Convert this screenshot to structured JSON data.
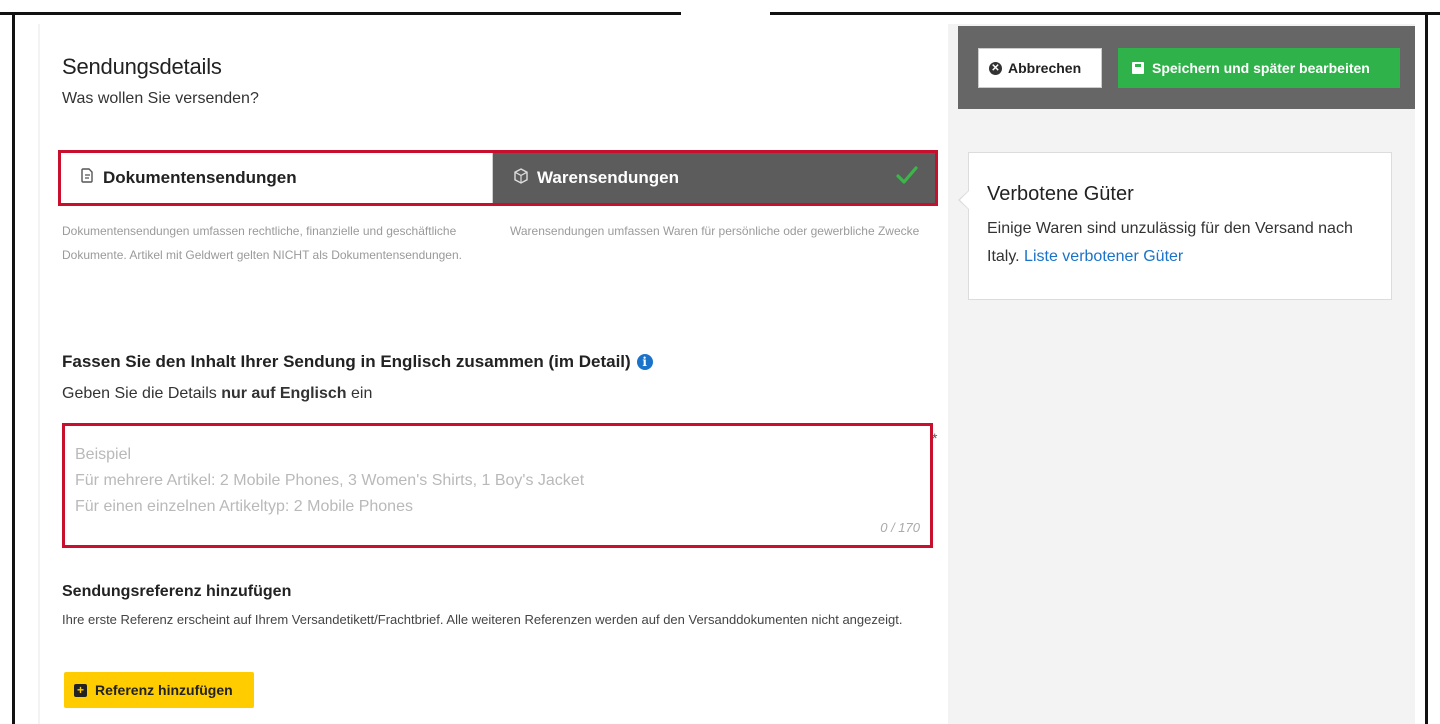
{
  "shipment": {
    "title": "Sendungsdetails",
    "subtitle": "Was wollen Sie versenden?",
    "options": [
      {
        "label": "Dokumentensendungen",
        "icon": "document-icon",
        "selected": false,
        "description": "Dokumentensendungen umfassen rechtliche, finanzielle und geschäftliche Dokumente. Artikel mit Geldwert gelten NICHT als Dokumentensendungen."
      },
      {
        "label": "Warensendungen",
        "icon": "package-icon",
        "selected": true,
        "description": "Warensendungen umfassen Waren für persönliche oder gewerbliche Zwecke"
      }
    ]
  },
  "summary": {
    "title": "Fassen Sie den Inhalt Ihrer Sendung in Englisch zusammen (im Detail)",
    "instruction_prefix": "Geben Sie die Details ",
    "instruction_bold": "nur auf Englisch",
    "instruction_suffix": " ein",
    "placeholder": "Beispiel\nFür mehrere Artikel: 2 Mobile Phones, 3 Women's Shirts, 1 Boy's Jacket\nFür einen einzelnen Artikeltyp: 2 Mobile Phones",
    "counter": "0 / 170",
    "required_marker": "*"
  },
  "reference": {
    "title": "Sendungsreferenz hinzufügen",
    "description": "Ihre erste Referenz erscheint auf Ihrem Versandetikett/Frachtbrief. Alle weiteren Referenzen werden auf den Versanddokumenten nicht angezeigt.",
    "button_label": "Referenz hinzufügen"
  },
  "actions": {
    "cancel_label": "Abbrechen",
    "save_label": "Speichern und später bearbeiten"
  },
  "prohibited": {
    "title": "Verbotene Güter",
    "text": "Einige Waren sind unzulässig für den Versand nach Italy. ",
    "link_label": "Liste verbotener Güter"
  },
  "colors": {
    "highlight_border": "#c8102e",
    "selected_option_bg": "#5c5c5c",
    "check_color": "#3cb54a",
    "save_button": "#2fb24a",
    "reference_button": "#ffcc00",
    "action_bar": "#666666",
    "link": "#1a73c9"
  }
}
